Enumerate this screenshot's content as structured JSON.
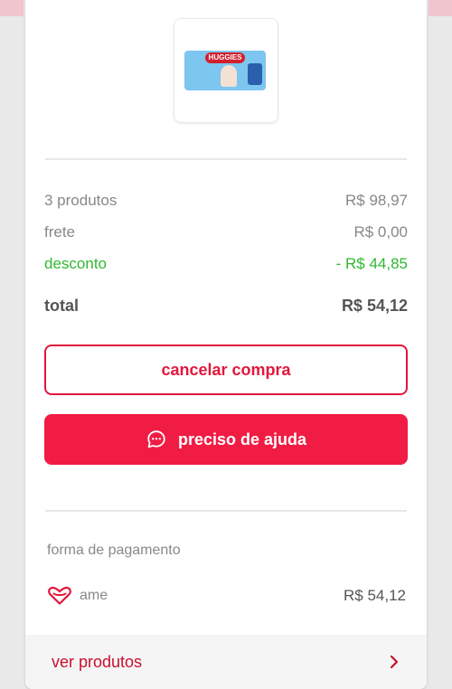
{
  "product": {
    "image_alt": "pacote de fraldas Huggies",
    "brand": "HUGGIES"
  },
  "summary": {
    "items_label": "3 produtos",
    "items_value": "R$ 98,97",
    "shipping_label": "frete",
    "shipping_value": "R$ 0,00",
    "discount_label": "desconto",
    "discount_value": "- R$ 44,85",
    "total_label": "total",
    "total_value": "R$ 54,12"
  },
  "actions": {
    "cancel_label": "cancelar compra",
    "help_label": "preciso de ajuda",
    "help_icon": "chat-bubble-icon"
  },
  "payment": {
    "section_label": "forma de pagamento",
    "method_icon": "ame-heart-icon",
    "method_name": "ame",
    "amount": "R$ 54,12"
  },
  "footer": {
    "view_products_label": "ver produtos",
    "chevron_icon": "chevron-right-icon"
  },
  "colors": {
    "primary": "#f01c44",
    "outline": "#e2173c",
    "discount": "#30b830",
    "muted_text": "#888888"
  }
}
